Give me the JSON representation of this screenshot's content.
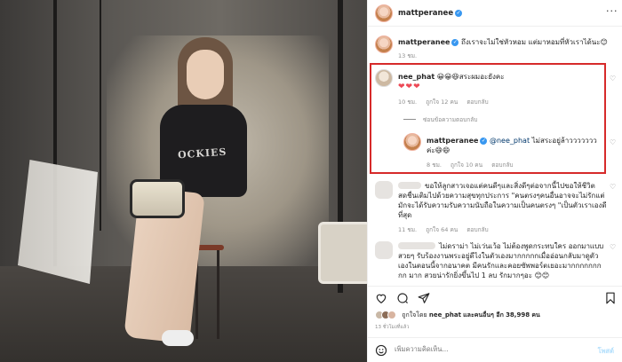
{
  "post_owner": {
    "username": "mattperanee",
    "verified": true
  },
  "caption": {
    "username": "mattperanee",
    "text": "ถึงเราจะไม่ใช่หัวหอม แต่มาหอมที่หัวเราได้นะ😊",
    "time": "13 ชม."
  },
  "comments": [
    {
      "username": "nee_phat",
      "text": "😀😀😆สระผมอะยังคะ",
      "hearts": "❤❤❤",
      "time": "10 ชม.",
      "likes": "ถูกใจ 12 คน",
      "reply_label": "ตอบกลับ",
      "hide_replies": "ซ่อนข้อความตอบกลับ",
      "reply": {
        "username": "mattperanee",
        "mention": "@nee_phat",
        "text": "ไม่สระอยู่ล้าวววววววค่ะ😄😄",
        "time": "8 ชม.",
        "likes": "ถูกใจ 10 คน",
        "reply_label": "ตอบกลับ"
      }
    },
    {
      "text": "ขอให้ลูกสาวเจอแต่คนดีๆและสิ่งดีๆต่อจากนี้ไปขอให้ชีวิตสดชื่นเติมไปด้วยความสุขทุกประการ \"คนตรงๆคนอื่นอาจจะไม่รักแต่มักจะได้รับความรับความนับถือในความเป็นคนตรงๆ \"เป็นตัวเราเองดีที่สุด",
      "time": "11 ชม.",
      "likes": "ถูกใจ 64 คน",
      "reply_label": "ตอบกลับ"
    },
    {
      "text": "ไม่ดราม่า ไม่เว่นเว้อ ไม่ต้องพูดกระทบใคร ออกมาแบบสวยๆ รับร้องงานพระอยู่ดีไงในตัวเองมากกกกกเมื่ออ่อนกลับมาดูตัวเองในตอนนี้จากอนาคต มีคนรักและคอยซัพพอร์ตเยอะมากกกกกกกกก มาก สวยน่ารักยิ่งขึ้นไป 1 ลบ รักมากๆอะ 😊😊",
      "likes": "",
      "reply_label": ""
    }
  ],
  "likes_summary": {
    "prefix": "ถูกใจโดย",
    "user": "nee_phat",
    "and": "และคนอื่นๆ อีก",
    "count": "38,998",
    "suffix": "คน"
  },
  "time_ago": "13 ชั่วโมงที่แล้ว",
  "add_comment": {
    "placeholder": "เพิ่มความคิดเห็น...",
    "post": "โพสต์"
  },
  "photo_shirt_text": "OCKIES",
  "colors": {
    "highlight": "#d62a2a",
    "verified": "#3897f0",
    "heart": "#ed4956"
  }
}
